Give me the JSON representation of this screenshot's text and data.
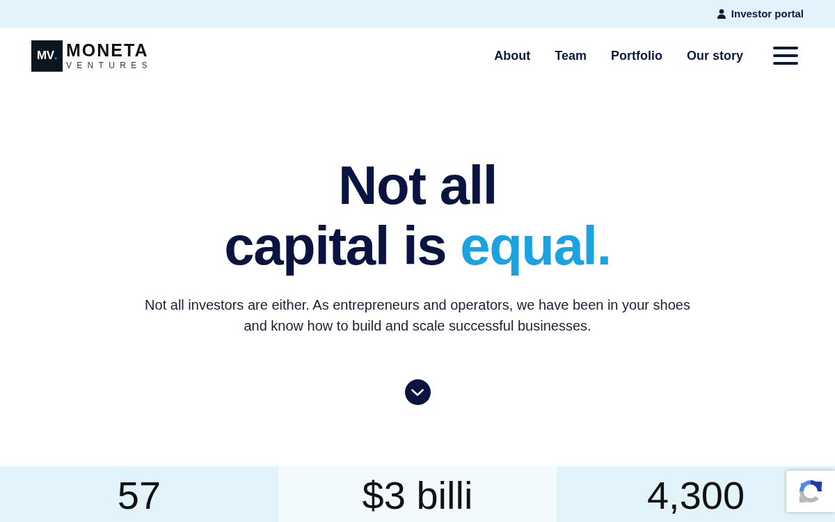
{
  "top_bar": {
    "link": {
      "label": "Investor portal"
    }
  },
  "header": {
    "logo": {
      "mark": [
        {
          "text": "MV",
          "accent": false
        },
        {
          "text": ".",
          "accent": true
        }
      ],
      "name": "MONETA",
      "tagline": "VENTURES"
    },
    "nav": [
      {
        "label": "About"
      },
      {
        "label": "Team"
      },
      {
        "label": "Portfolio"
      },
      {
        "label": "Our story"
      }
    ]
  },
  "hero": {
    "headline": [
      [
        {
          "text": "Not all",
          "accent": false
        }
      ],
      [
        {
          "text": "capital is ",
          "accent": false
        },
        {
          "text": "equal.",
          "accent": true
        }
      ]
    ],
    "text": "Not all investors are either. As entrepreneurs and operators, we have been in your shoes and know how to build and scale successful businesses."
  },
  "stats": [
    {
      "value": "57"
    },
    {
      "value": "$3 billi"
    },
    {
      "value": "4,300"
    }
  ]
}
